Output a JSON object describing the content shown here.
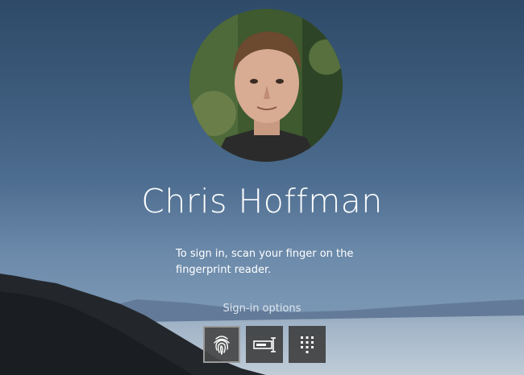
{
  "user": {
    "name": "Chris Hoffman",
    "avatar_icon": "user-avatar-photo"
  },
  "signin": {
    "instruction": "To sign in, scan your finger on the fingerprint reader.",
    "options_label": "Sign-in options",
    "options": [
      {
        "id": "fingerprint",
        "icon": "fingerprint-icon",
        "selected": true
      },
      {
        "id": "password",
        "icon": "password-key-icon",
        "selected": false
      },
      {
        "id": "pin",
        "icon": "pin-keypad-icon",
        "selected": false
      }
    ]
  },
  "colors": {
    "text": "#ffffff",
    "button_bg": "#3a3a3a",
    "selected_border": "#9a9a9a"
  }
}
